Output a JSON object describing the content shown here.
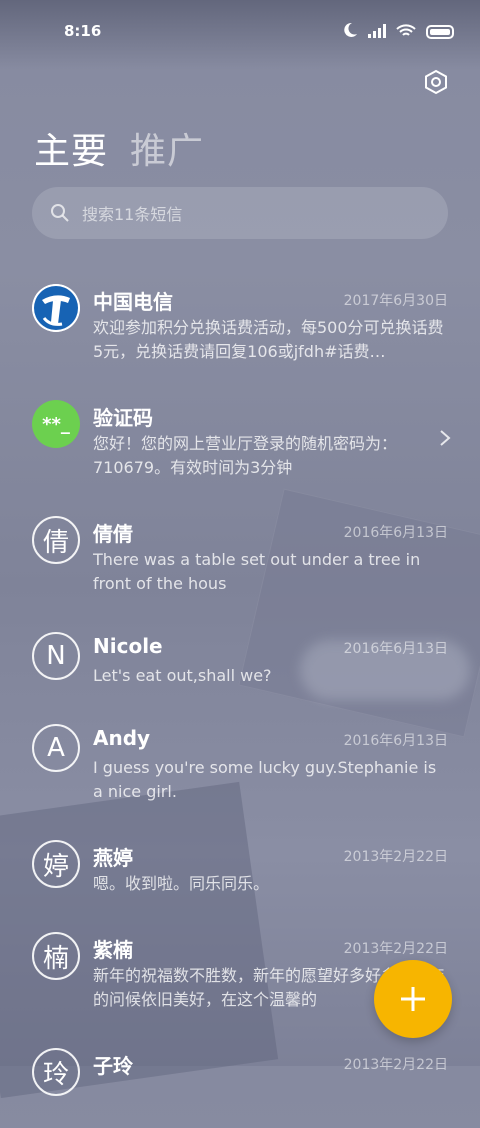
{
  "status_bar": {
    "time": "8:16",
    "icons": [
      "moon-icon",
      "signal-icon",
      "wifi-icon",
      "battery-icon"
    ]
  },
  "header": {
    "settings_icon": "gear-icon"
  },
  "tabs": [
    {
      "label": "主要",
      "active": true
    },
    {
      "label": "推广",
      "active": false
    }
  ],
  "search": {
    "placeholder": "搜索11条短信"
  },
  "conversations": [
    {
      "avatar": "telecom-logo",
      "name": "中国电信",
      "date": "2017年6月30日",
      "preview": "欢迎参加积分兑换话费活动，每500分可兑换话费5元，兑换话费请回复106或jfdh#话费…"
    },
    {
      "avatar": "**_",
      "name": "验证码",
      "date": "",
      "preview": "您好！您的网上营业厅登录的随机密码为：710679。有效时间为3分钟"
    },
    {
      "avatar": "倩",
      "name": "倩倩",
      "date": "2016年6月13日",
      "preview": "There was a table set out under a tree in front of the hous"
    },
    {
      "avatar": "N",
      "name": "Nicole",
      "date": "2016年6月13日",
      "preview": "Let's eat out,shall we?"
    },
    {
      "avatar": "A",
      "name": "Andy",
      "date": "2016年6月13日",
      "preview": "I guess you're some lucky guy.Stephanie is a nice girl."
    },
    {
      "avatar": "婷",
      "name": "燕婷",
      "date": "2013年2月22日",
      "preview": "嗯。收到啦。同乐同乐。"
    },
    {
      "avatar": "楠",
      "name": "紫楠",
      "date": "2013年2月22日",
      "preview": "新年的祝福数不胜数，新年的愿望好多好多，新年的问候依旧美好，在这个温馨的"
    },
    {
      "avatar": "玲",
      "name": "子玲",
      "date": "2013年2月22日",
      "preview": ""
    }
  ],
  "fab": {
    "icon": "plus-icon"
  },
  "colors": {
    "fab": "#f7b500",
    "verify_avatar": "#6cd04f",
    "telecom_blue": "#1763b4"
  }
}
